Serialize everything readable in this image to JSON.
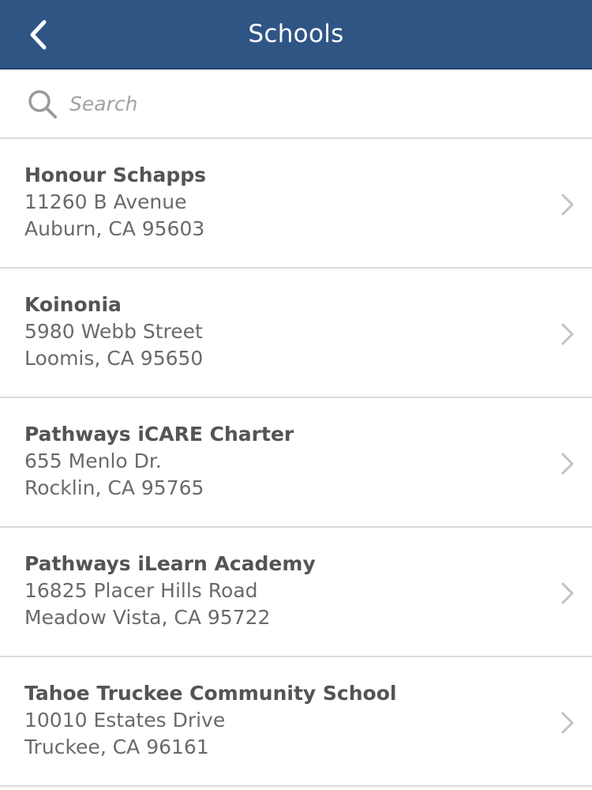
{
  "header": {
    "title": "Schools",
    "back_icon": "chevron-left-icon",
    "background_color": "#2f5585"
  },
  "search": {
    "placeholder": "Search",
    "value": "",
    "icon": "search-icon"
  },
  "schools": [
    {
      "name": "Honour Schapps",
      "address": "11260 B Avenue",
      "city_state_zip": "Auburn, CA 95603"
    },
    {
      "name": "Koinonia",
      "address": "5980 Webb Street",
      "city_state_zip": "Loomis, CA 95650"
    },
    {
      "name": "Pathways iCARE Charter",
      "address": "655 Menlo Dr.",
      "city_state_zip": "Rocklin, CA 95765"
    },
    {
      "name": "Pathways iLearn Academy",
      "address": "16825 Placer Hills Road",
      "city_state_zip": "Meadow Vista, CA 95722"
    },
    {
      "name": "Tahoe Truckee Community School",
      "address": "10010 Estates Drive",
      "city_state_zip": "Truckee, CA 96161"
    }
  ]
}
